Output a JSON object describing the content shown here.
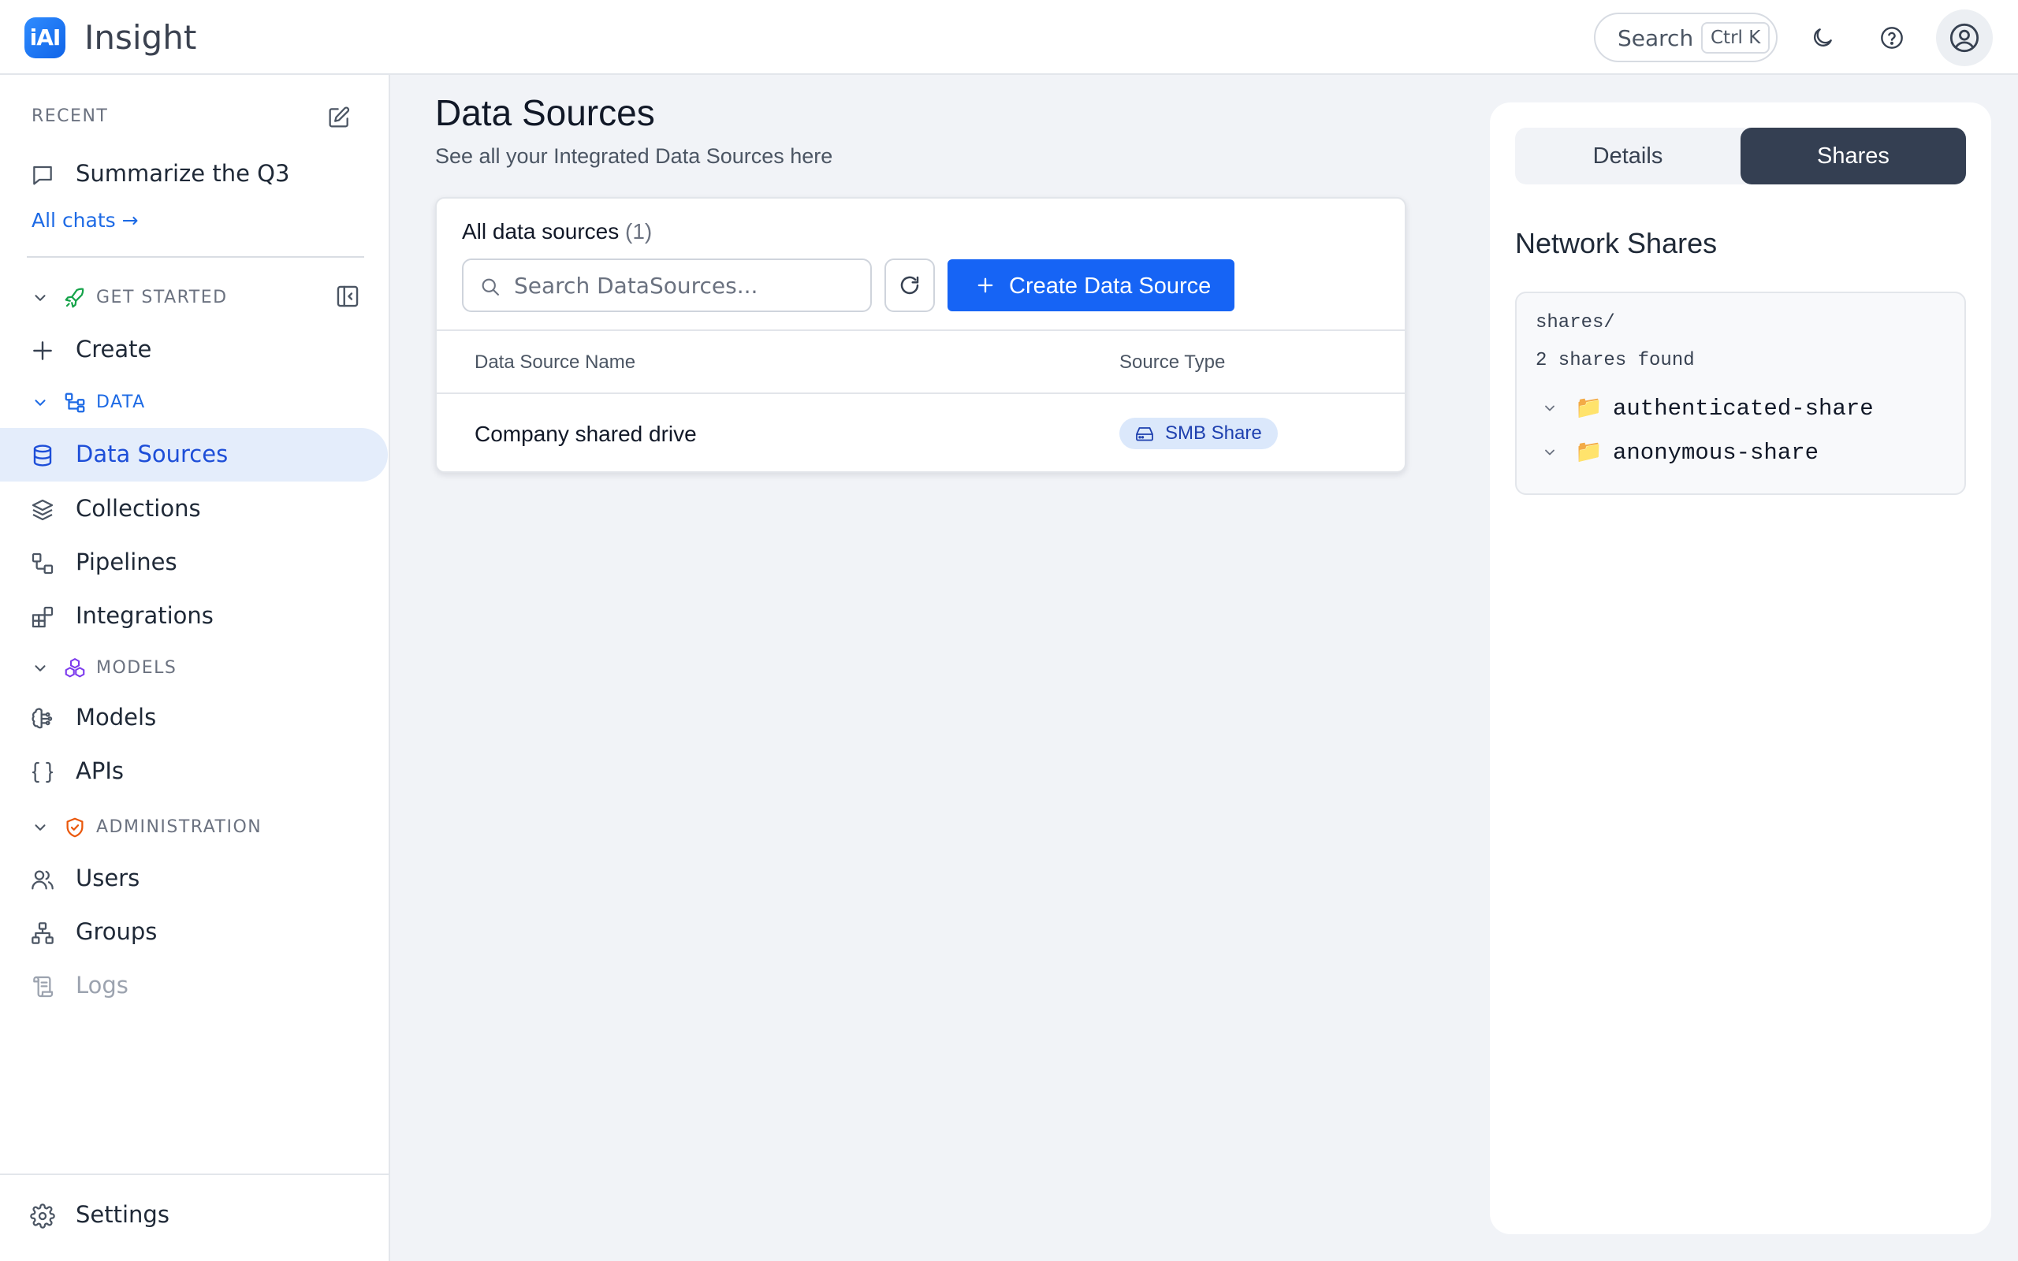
{
  "app": {
    "logo_text": "iAI",
    "title": "Insight"
  },
  "topbar": {
    "search_label": "Search",
    "search_shortcut": "Ctrl K",
    "icons": [
      "moon-icon",
      "help-circle-icon",
      "user-circle-icon"
    ]
  },
  "sidebar": {
    "recent_label": "RECENT",
    "recent_chat": "Summarize the Q3",
    "all_chats": "All chats →",
    "groups": {
      "get_started": "GET STARTED",
      "data": "DATA",
      "models": "MODELS",
      "administration": "ADMINISTRATION"
    },
    "items": {
      "create": "Create",
      "data_sources": "Data Sources",
      "collections": "Collections",
      "pipelines": "Pipelines",
      "integrations": "Integrations",
      "models": "Models",
      "apis": "APIs",
      "users": "Users",
      "groups": "Groups",
      "logs": "Logs",
      "settings": "Settings"
    }
  },
  "main": {
    "title": "Data Sources",
    "subtitle": "See all your Integrated Data Sources here",
    "card": {
      "title": "All data sources",
      "count": "(1)",
      "search_placeholder": "Search DataSources...",
      "create_button": "Create Data Source",
      "columns": [
        "Data Source Name",
        "Source Type"
      ],
      "rows": [
        {
          "name": "Company shared drive",
          "type": "SMB Share"
        }
      ]
    }
  },
  "panel": {
    "tabs": [
      "Details",
      "Shares"
    ],
    "selected_tab": "Shares",
    "title": "Network Shares",
    "path": "shares/",
    "found": "2 shares found",
    "shares": [
      "authenticated-share",
      "anonymous-share"
    ]
  },
  "colors": {
    "primary": "#1664f5",
    "active_nav_bg": "#e4edfb",
    "selected_tab_bg": "#343f52",
    "badge_bg": "#dbe8fb"
  }
}
